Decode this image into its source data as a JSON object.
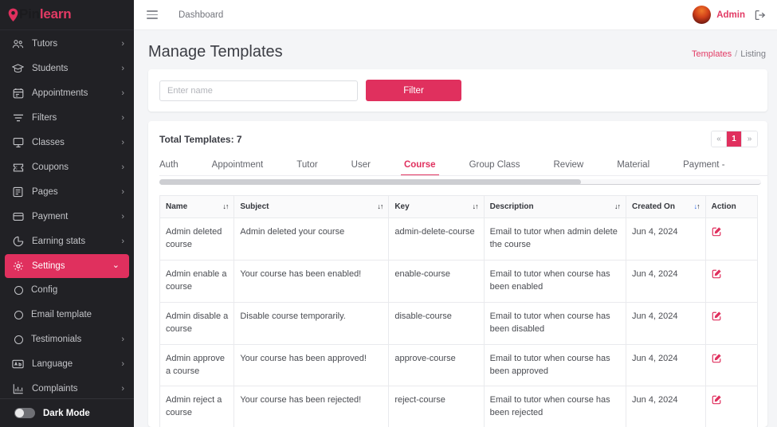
{
  "brand": {
    "logo_dark": "Pin",
    "logo_accent": "learn",
    "accent_color": "#e0305e",
    "sidebar_bg": "#212125"
  },
  "sidebar": {
    "items": [
      {
        "label": "Tutors",
        "icon": "users-icon",
        "chevron": "›",
        "active": false
      },
      {
        "label": "Students",
        "icon": "graduation-cap-icon",
        "chevron": "›",
        "active": false
      },
      {
        "label": "Appointments",
        "icon": "calendar-icon",
        "chevron": "›",
        "active": false
      },
      {
        "label": "Filters",
        "icon": "filter-icon",
        "chevron": "›",
        "active": false
      },
      {
        "label": "Classes",
        "icon": "desktop-icon",
        "chevron": "›",
        "active": false
      },
      {
        "label": "Coupons",
        "icon": "ticket-icon",
        "chevron": "›",
        "active": false
      },
      {
        "label": "Pages",
        "icon": "page-icon",
        "chevron": "›",
        "active": false
      },
      {
        "label": "Payment",
        "icon": "card-icon",
        "chevron": "›",
        "active": false
      },
      {
        "label": "Earning stats",
        "icon": "pie-chart-icon",
        "chevron": "›",
        "active": false
      },
      {
        "label": "Settings",
        "icon": "gear-icon",
        "chevron": "⌄",
        "active": true
      }
    ],
    "sub_items": [
      {
        "label": "Config",
        "chevron": ""
      },
      {
        "label": "Email template",
        "chevron": ""
      },
      {
        "label": "Testimonials",
        "chevron": "›"
      }
    ],
    "items_after": [
      {
        "label": "Language",
        "icon": "language-icon",
        "chevron": "›"
      },
      {
        "label": "Complaints",
        "icon": "bar-chart-icon",
        "chevron": "›"
      }
    ],
    "dark_mode_label": "Dark Mode",
    "dark_mode_on": false
  },
  "topbar": {
    "menu_icon": "hamburger-icon",
    "breadcrumb_label": "Dashboard",
    "user_name": "Admin",
    "logout_icon": "logout-icon"
  },
  "page": {
    "title": "Manage Templates",
    "breadcrumb_link": "Templates",
    "breadcrumb_separator": "/",
    "breadcrumb_current": "Listing"
  },
  "filter": {
    "placeholder": "Enter name",
    "value": "",
    "button_label": "Filter"
  },
  "listing": {
    "total_label": "Total Templates: 7",
    "pagination": {
      "prev": "«",
      "pages": [
        "1"
      ],
      "next": "»",
      "active_page": "1"
    },
    "tabs": [
      {
        "label": "Auth",
        "active": false
      },
      {
        "label": "Appointment",
        "active": false
      },
      {
        "label": "Tutor",
        "active": false
      },
      {
        "label": "User",
        "active": false
      },
      {
        "label": "Course",
        "active": true
      },
      {
        "label": "Group Class",
        "active": false
      },
      {
        "label": "Review",
        "active": false
      },
      {
        "label": "Material",
        "active": false
      },
      {
        "label": "Payment -",
        "active": false
      }
    ]
  },
  "table": {
    "columns": [
      {
        "label": "Name",
        "sortable": true,
        "sort_active": false
      },
      {
        "label": "Subject",
        "sortable": true,
        "sort_active": false
      },
      {
        "label": "Key",
        "sortable": true,
        "sort_active": false
      },
      {
        "label": "Description",
        "sortable": true,
        "sort_active": false
      },
      {
        "label": "Created On",
        "sortable": true,
        "sort_active": true
      },
      {
        "label": "Action",
        "sortable": false,
        "sort_active": false
      }
    ],
    "rows": [
      {
        "name": "Admin deleted course",
        "subject": "Admin deleted your course",
        "key": "admin-delete-course",
        "description": "Email to tutor when admin delete the course",
        "created_on": "Jun 4, 2024",
        "action_icon": "edit-icon"
      },
      {
        "name": "Admin enable a course",
        "subject": "Your course has been enabled!",
        "key": "enable-course",
        "description": "Email to tutor when course has been enabled",
        "created_on": "Jun 4, 2024",
        "action_icon": "edit-icon"
      },
      {
        "name": "Admin disable a course",
        "subject": "Disable course temporarily.",
        "key": "disable-course",
        "description": "Email to tutor when course has been disabled",
        "created_on": "Jun 4, 2024",
        "action_icon": "edit-icon"
      },
      {
        "name": "Admin approve a course",
        "subject": "Your course has been approved!",
        "key": "approve-course",
        "description": "Email to tutor when course has been approved",
        "created_on": "Jun 4, 2024",
        "action_icon": "edit-icon"
      },
      {
        "name": "Admin reject a course",
        "subject": "Your course has been rejected!",
        "key": "reject-course",
        "description": "Email to tutor when course has been rejected",
        "created_on": "Jun 4, 2024",
        "action_icon": "edit-icon"
      }
    ]
  }
}
